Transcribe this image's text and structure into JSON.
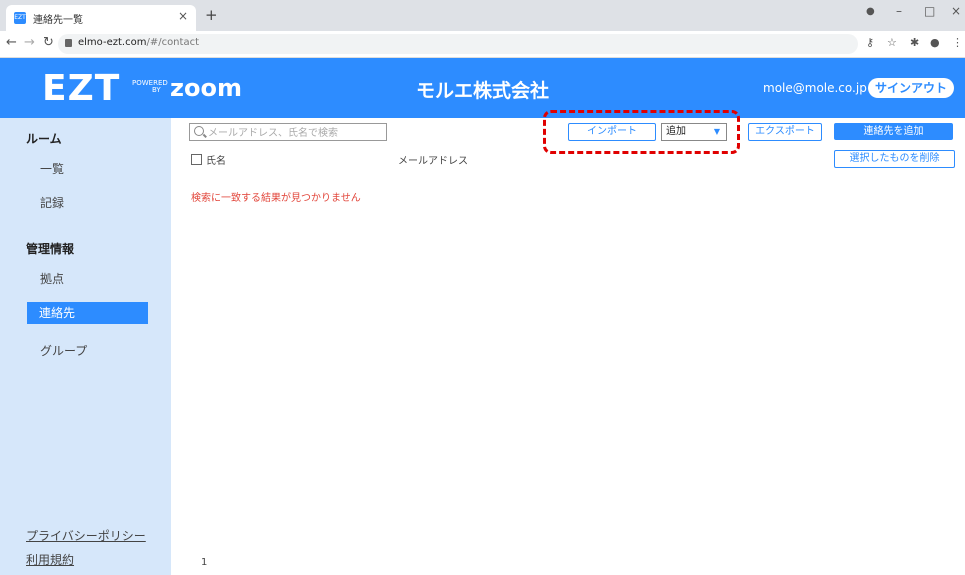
{
  "browser": {
    "tab_title": "連絡先一覧",
    "favicon_text": "EZT",
    "tab_close": "×",
    "new_tab": "+",
    "url_host": "elmo-ezt.com",
    "url_path": "/#/contact"
  },
  "header": {
    "logo_text": "EZT",
    "powered_line1": "POWERED",
    "powered_line2": "BY",
    "zoom_text": "zoom",
    "company_name": "モルエ株式会社",
    "user_email": "mole@mole.co.jp",
    "signout_label": "サインアウト",
    "background_color": "#2d8cff"
  },
  "sidebar": {
    "section_room": "ルーム",
    "item_list": "一覧",
    "item_records": "記録",
    "section_admin": "管理情報",
    "item_sites": "拠点",
    "item_contacts": "連絡先",
    "item_groups": "グループ",
    "link_privacy": "プライバシーポリシー",
    "link_terms": "利用規約"
  },
  "toolbar": {
    "search_placeholder": "メールアドレス、氏名で検索",
    "import_label": "インポート",
    "mode_select_value": "追加",
    "export_label": "エクスポート",
    "add_contact_label": "連絡先を追加",
    "delete_selected_label": "選択したものを削除"
  },
  "table": {
    "col_name": "氏名",
    "col_email": "メールアドレス",
    "empty_message": "検索に一致する結果が見つかりません"
  },
  "pagination": {
    "current_page": "1"
  }
}
